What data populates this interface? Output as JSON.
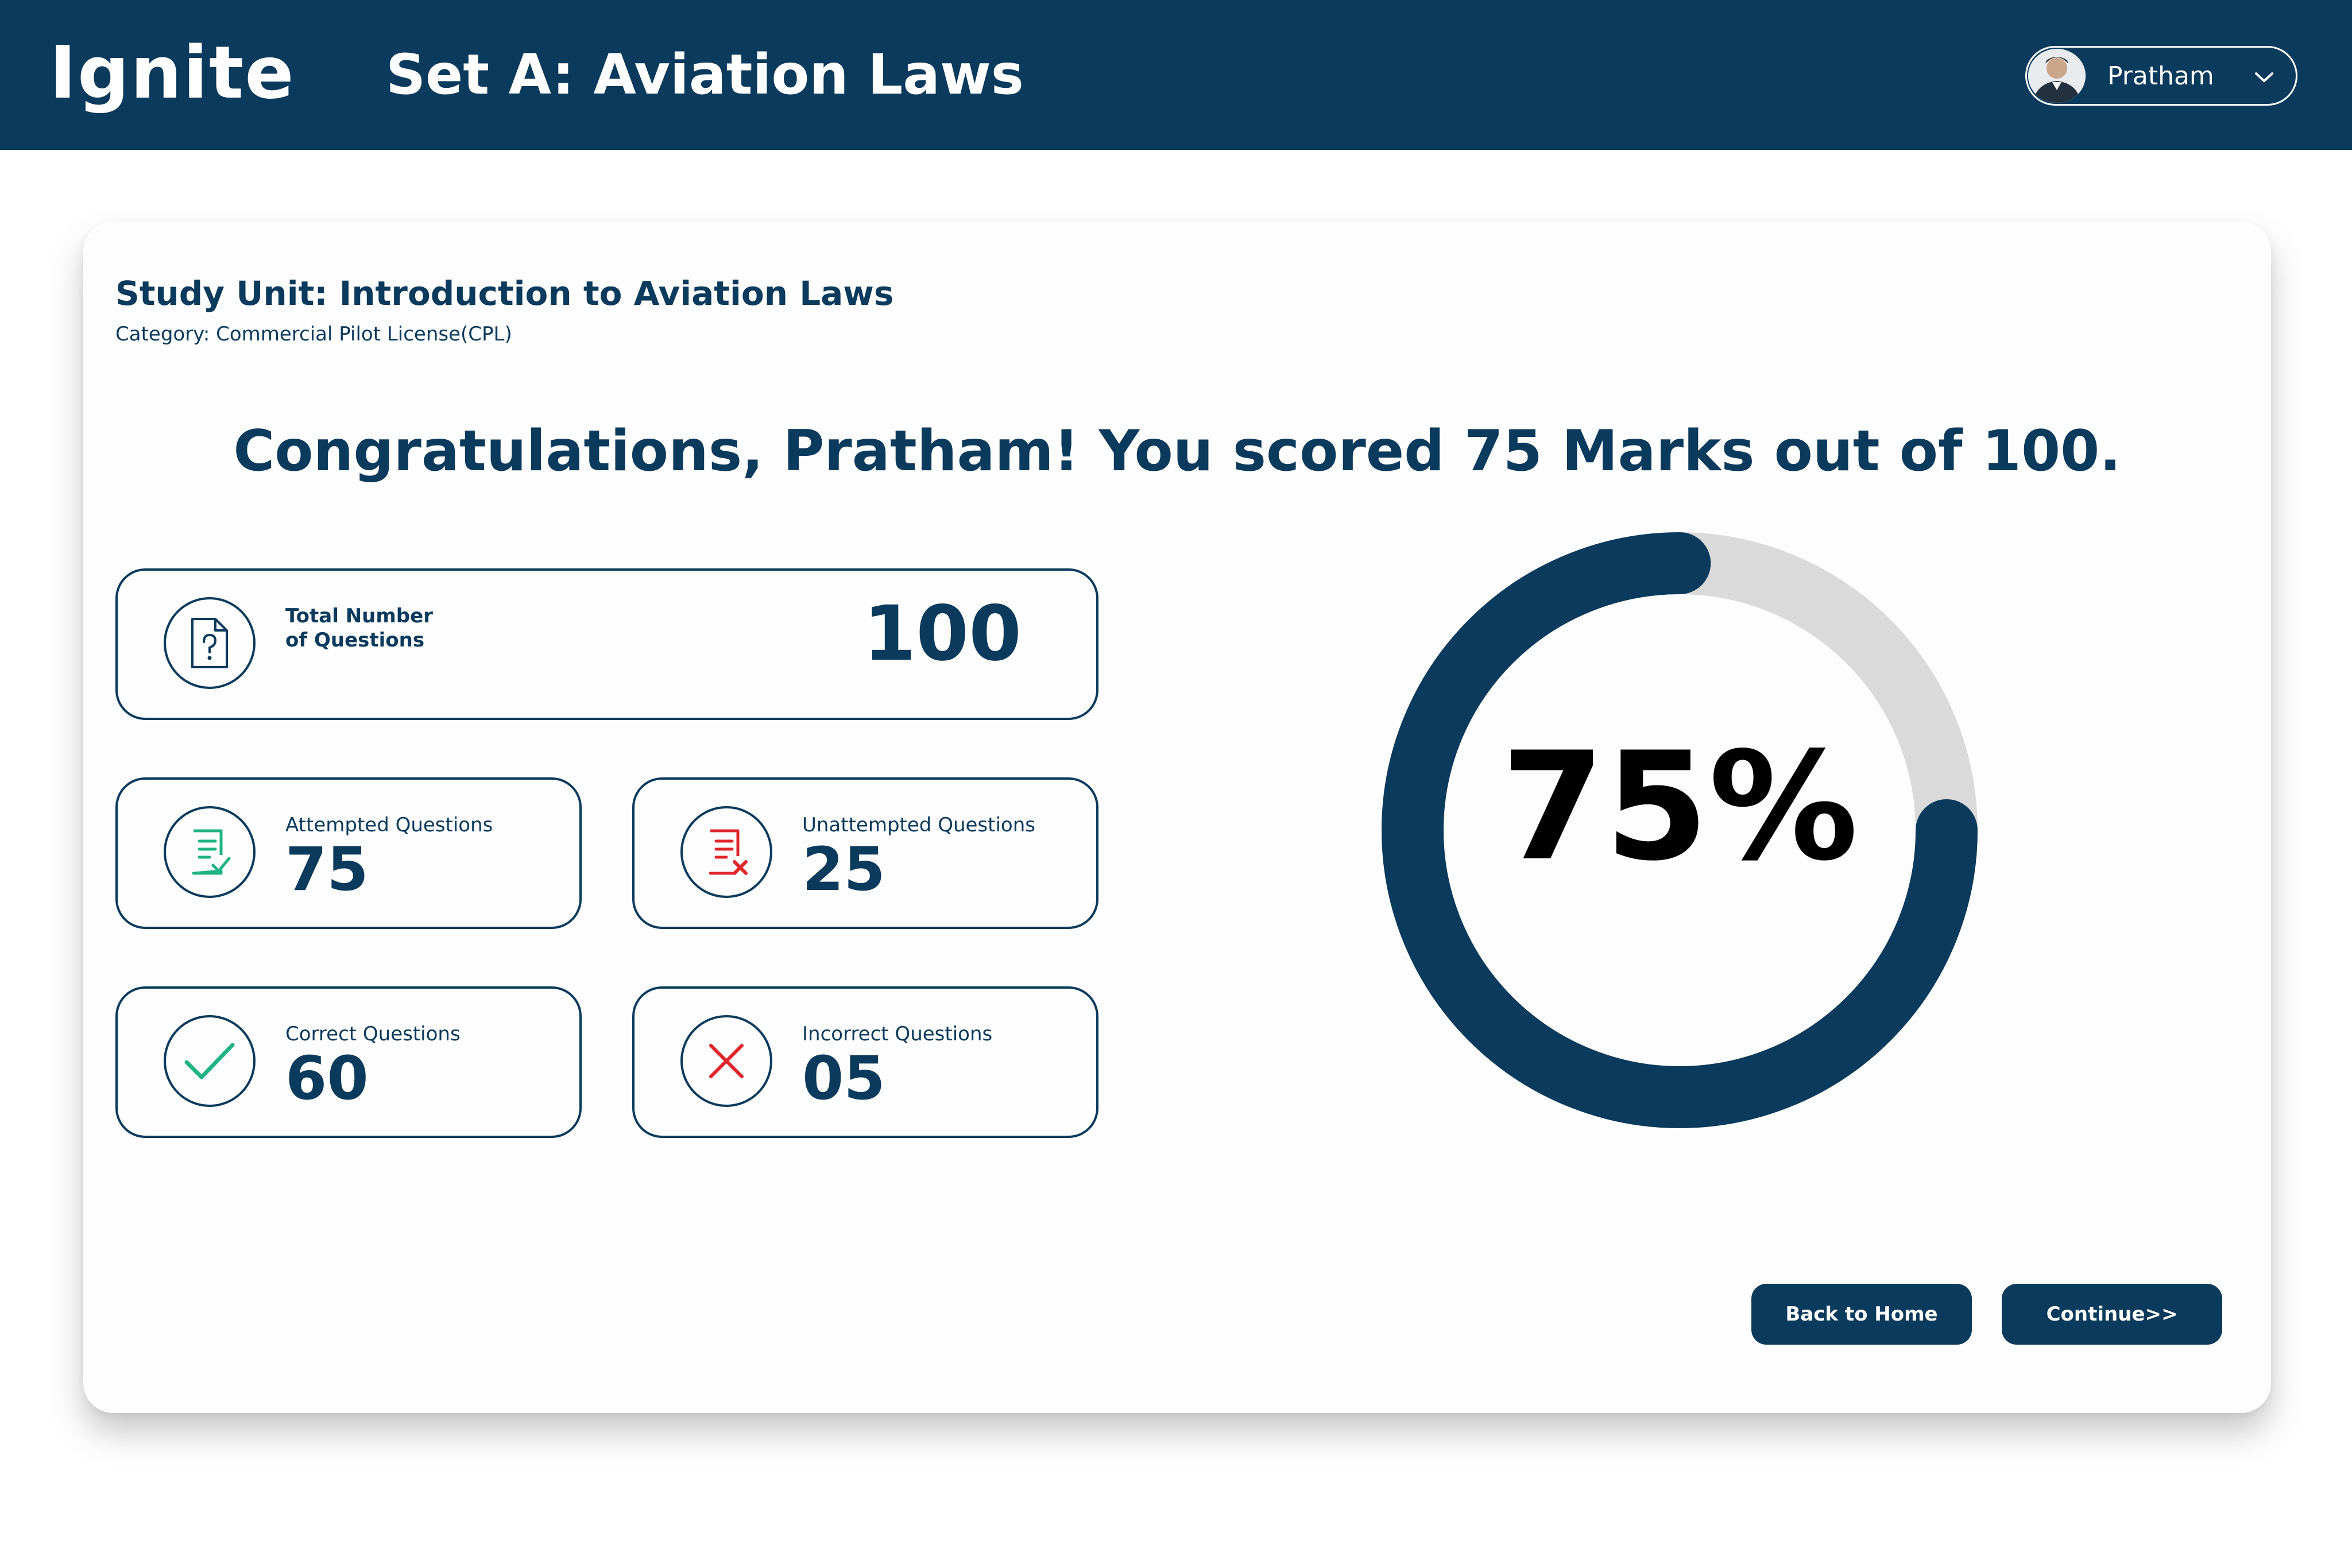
{
  "header": {
    "logo": "Ignite",
    "set_title": "Set A: Aviation Laws",
    "user": {
      "name": "Pratham",
      "avatar_icon": "user-avatar",
      "menu_icon": "chevron-down-icon"
    }
  },
  "result": {
    "study_unit": "Study Unit: Introduction to Aviation Laws",
    "category": "Category: Commercial Pilot License(CPL)",
    "congrats_prefix": "Congratulations, Pratham!  You scored ",
    "score": "75",
    "congrats_middle": " Marks out of ",
    "max_score": "100",
    "congrats_suffix": "."
  },
  "stats": {
    "total": {
      "label": "Total Number of Questions",
      "value": "100",
      "icon": "question-document-icon"
    },
    "attempted": {
      "label": "Attempted Questions",
      "value": "75",
      "icon": "checklist-icon",
      "icon_color": "#1fb383"
    },
    "unattempted": {
      "label": "Unattempted Questions",
      "value": "25",
      "icon": "document-x-icon",
      "icon_color": "#e0262b"
    },
    "correct": {
      "label": "Correct Questions",
      "value": "60",
      "icon": "checkmark-icon",
      "icon_color": "#1fb383"
    },
    "incorrect": {
      "label": "Incorrect Questions",
      "value": "05",
      "icon": "close-icon",
      "icon_color": "#e0262b"
    }
  },
  "progress": {
    "percent_label": "75%",
    "fraction": 0.75,
    "fill_color": "#0a3a5c",
    "track_color": "#dadada"
  },
  "actions": {
    "back_label": "Back to Home",
    "continue_label": "Continue>>"
  }
}
